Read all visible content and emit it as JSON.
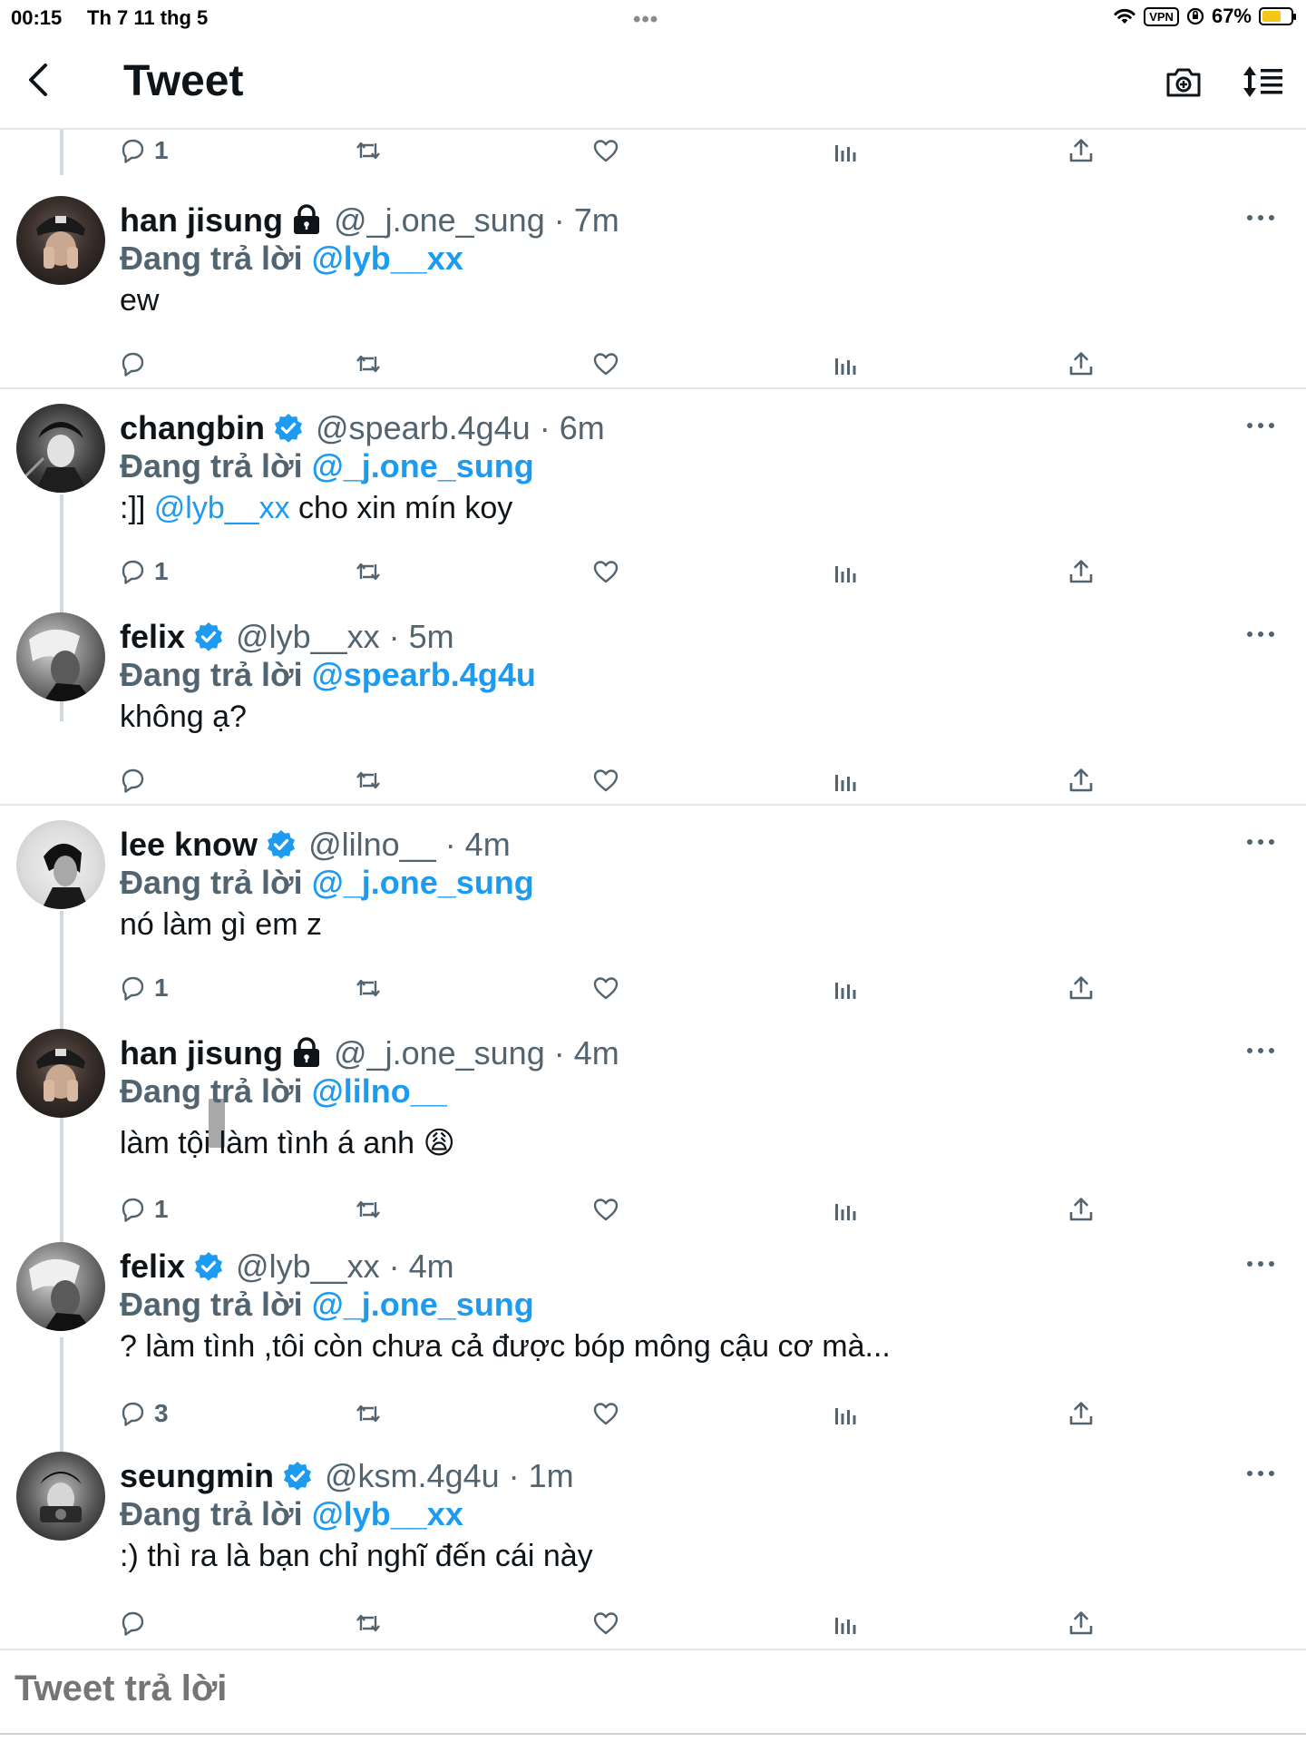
{
  "status": {
    "time": "00:15",
    "date": "Th 7 11 thg 5",
    "dots": "•••",
    "vpn": "VPN",
    "battery": "67%"
  },
  "header": {
    "title": "Tweet"
  },
  "top_actions": {
    "reply_count": "1"
  },
  "tweets": [
    {
      "name": "han jisung",
      "badge": "lock",
      "handle_time": "@_j.one_sung · 7m",
      "reply_prefix": "Đang trả lời",
      "reply_to": "@lyb__xx",
      "text": "ew",
      "reply_count": ""
    },
    {
      "name": "changbin",
      "badge": "verified",
      "handle_time": "@spearb.4g4u · 6m",
      "reply_prefix": "Đang trả lời",
      "reply_to": "@_j.one_sung",
      "text_pre": ":]] ",
      "text_mention": "@lyb__xx",
      "text_post": " cho xin mín koy",
      "reply_count": "1"
    },
    {
      "name": "felix",
      "badge": "verified",
      "handle_time": "@lyb__xx · 5m",
      "reply_prefix": "Đang trả lời",
      "reply_to": "@spearb.4g4u",
      "text": "không ạ?",
      "reply_count": ""
    },
    {
      "name": "lee know",
      "badge": "verified",
      "handle_time": "@lilno__ · 4m",
      "reply_prefix": "Đang trả lời",
      "reply_to": "@_j.one_sung",
      "text": "nó làm gì em z",
      "reply_count": "1"
    },
    {
      "name": "han jisung",
      "badge": "lock",
      "handle_time": "@_j.one_sung · 4m",
      "reply_prefix": "Đang trả lời",
      "reply_to": "@lilno__",
      "text": "làm tội làm tình á anh",
      "emoji": "😩",
      "reply_count": "1"
    },
    {
      "name": "felix",
      "badge": "verified",
      "handle_time": "@lyb__xx · 4m",
      "reply_prefix": "Đang trả lời",
      "reply_to": "@_j.one_sung",
      "text": "? làm tình ,tôi còn chưa cả được bóp mông cậu cơ mà...",
      "reply_count": "3"
    },
    {
      "name": "seungmin",
      "badge": "verified",
      "handle_time": "@ksm.4g4u · 1m",
      "reply_prefix": "Đang trả lời",
      "reply_to": "@lyb__xx",
      "text": ":) thì ra là bạn chỉ nghĩ đến cái này",
      "reply_count": ""
    }
  ],
  "composer": {
    "placeholder": "Tweet trả lời"
  },
  "icons": {
    "reply": "comment-icon",
    "retweet": "retweet-icon",
    "like": "heart-icon",
    "stats": "analytics-icon",
    "share": "share-icon",
    "more": "more-icon",
    "verified": "verified-badge-icon",
    "lock": "lock-icon"
  },
  "colors": {
    "accent": "#1d9bf0",
    "secondary_text": "#536471",
    "primary_text": "#0f1419",
    "battery": "#f5c518"
  }
}
